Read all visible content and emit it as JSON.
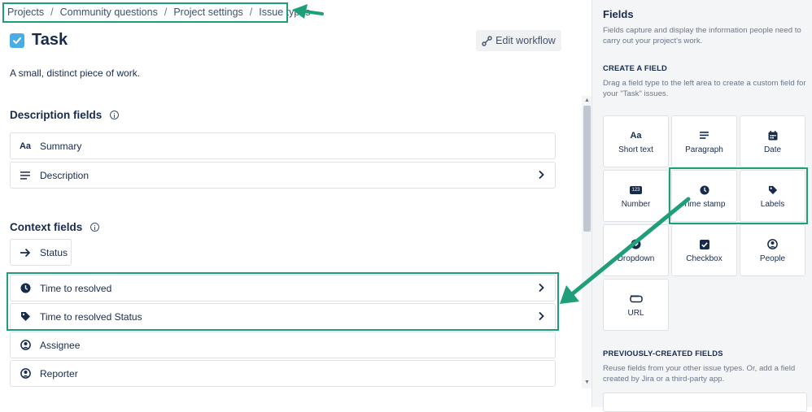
{
  "breadcrumb": [
    "Projects",
    "Community questions",
    "Project settings",
    "Issue types"
  ],
  "issue_type": {
    "title": "Task",
    "description": "A small, distinct piece of work."
  },
  "edit_workflow_label": "Edit workflow",
  "description_fields": {
    "heading": "Description fields",
    "items": [
      {
        "label": "Summary",
        "icon": "text-aa-icon"
      },
      {
        "label": "Description",
        "icon": "paragraph-icon"
      }
    ]
  },
  "context_fields": {
    "heading": "Context fields",
    "status": {
      "label": "Status",
      "icon": "arrow-right-icon"
    },
    "items": [
      {
        "label": "Time to resolved",
        "icon": "clock-icon"
      },
      {
        "label": "Time to resolved Status",
        "icon": "tag-icon"
      },
      {
        "label": "Assignee",
        "icon": "person-icon"
      },
      {
        "label": "Reporter",
        "icon": "person-icon"
      }
    ]
  },
  "panel": {
    "title": "Fields",
    "description": "Fields capture and display the information people need to carry out your project's work.",
    "create_heading": "CREATE A FIELD",
    "create_description": "Drag a field type to the left area to create a custom field for your \"Task\" issues.",
    "field_types": [
      {
        "label": "Short text",
        "icon": "text-aa-icon"
      },
      {
        "label": "Paragraph",
        "icon": "paragraph-icon"
      },
      {
        "label": "Date",
        "icon": "calendar-icon"
      },
      {
        "label": "Number",
        "icon": "number-icon"
      },
      {
        "label": "Time stamp",
        "icon": "clock-icon"
      },
      {
        "label": "Labels",
        "icon": "tag-icon"
      },
      {
        "label": "Dropdown",
        "icon": "dropdown-icon"
      },
      {
        "label": "Checkbox",
        "icon": "checkbox-icon"
      },
      {
        "label": "People",
        "icon": "person-icon"
      },
      {
        "label": "URL",
        "icon": "link-icon"
      }
    ],
    "previous_heading": "PREVIOUSLY-CREATED FIELDS",
    "previous_description": "Reuse fields from your other issue types. Or, add a field created by Jira or a third-party app."
  },
  "number_icon_text": "123",
  "text_icon_glyph": "Aa",
  "colors": {
    "highlight": "#1f9e7a",
    "task_icon": "#4bade8"
  }
}
